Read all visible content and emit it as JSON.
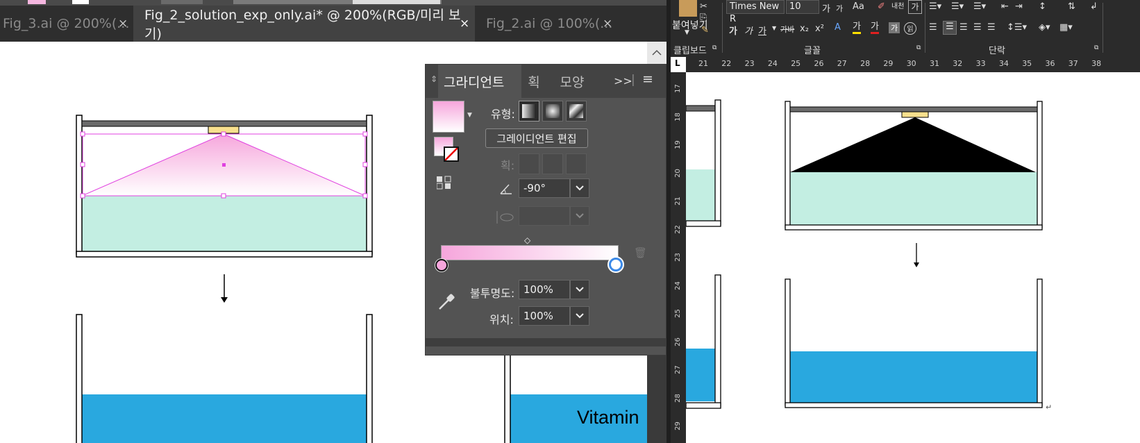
{
  "illustrator": {
    "tabs": [
      {
        "label": "Fig_3.ai @ 200%(...",
        "active": false
      },
      {
        "label": "Fig_2_solution_exp_only.ai*  @  200%(RGB/미리 보기)",
        "active": true
      },
      {
        "label": "Fig_2.ai @ 100%(...",
        "active": false
      }
    ],
    "close_glyph": "×",
    "canvas_text": "Vitamin",
    "gradient_panel": {
      "tabs": [
        "그라디언트",
        "획",
        "모양"
      ],
      "expand_glyph": ">>",
      "type_label": "유형:",
      "edit_button": "그레이디언트 편집",
      "stroke_label": "획:",
      "angle_value": "-90°",
      "opacity_label": "불투명도:",
      "opacity_value": "100%",
      "location_label": "위치:",
      "location_value": "100%",
      "gradient_start_color": "#f6a6dc",
      "gradient_end_color": "#ffffff"
    }
  },
  "word": {
    "ribbon": {
      "paste_label": "붙여넣기",
      "clipboard_group": "클립보드",
      "font_name": "Times New R",
      "font_size": "10",
      "font_group": "글꼴",
      "paragraph_group": "단락",
      "font_buttons": [
        "가",
        "가",
        "Aa"
      ],
      "format_buttons": [
        "가",
        "가",
        "가",
        "가바",
        "x₂",
        "x²"
      ]
    },
    "ruler_h": [
      "21",
      "22",
      "23",
      "24",
      "25",
      "26",
      "27",
      "28",
      "29",
      "30",
      "31",
      "32",
      "33",
      "34",
      "35",
      "36",
      "37",
      "38"
    ],
    "ruler_v": [
      "17",
      "18",
      "19",
      "20",
      "21",
      "22",
      "23",
      "24",
      "25",
      "26",
      "27",
      "28",
      "29"
    ],
    "paragraph_mark": "↵"
  },
  "colors": {
    "water_blue": "#29a8df",
    "mint": "#c3eee2",
    "lamp": "#f8e08e",
    "selection": "#e040e0"
  }
}
